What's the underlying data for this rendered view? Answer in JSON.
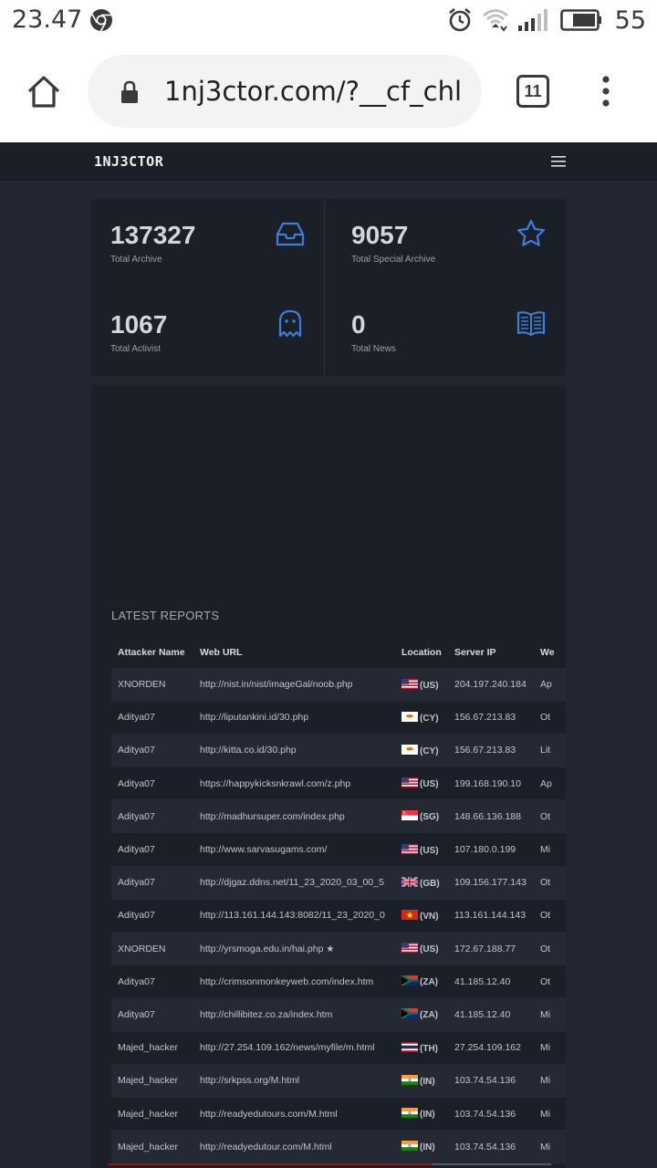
{
  "status_bar": {
    "time": "23.47",
    "battery": "55"
  },
  "browser": {
    "url": "1nj3ctor.com/?__cf_chl",
    "tab_count": "11"
  },
  "site": {
    "logo": "1NJ3CTOR"
  },
  "stats": [
    {
      "value": "137327",
      "label": "Total Archive",
      "icon": "inbox-icon"
    },
    {
      "value": "9057",
      "label": "Total Special Archive",
      "icon": "star-icon"
    },
    {
      "value": "1067",
      "label": "Total Activist",
      "icon": "ghost-icon"
    },
    {
      "value": "0",
      "label": "Total News",
      "icon": "book-icon"
    }
  ],
  "reports": {
    "title": "LATEST REPORTS",
    "columns": [
      "Attacker Name",
      "Web URL",
      "Location",
      "Server IP",
      "We"
    ],
    "rows": [
      {
        "attacker": "XNORDEN",
        "url": "http://nist.in/nist/imageGal/noob.php",
        "flag": "us",
        "cc": "(US)",
        "ip": "204.197.240.184",
        "web": "Ap"
      },
      {
        "attacker": "Aditya07",
        "url": "http://liputankini.id/30.php",
        "flag": "cy",
        "cc": "(CY)",
        "ip": "156.67.213.83",
        "web": "Ot"
      },
      {
        "attacker": "Aditya07",
        "url": "http://kitta.co.id/30.php",
        "flag": "cy",
        "cc": "(CY)",
        "ip": "156.67.213.83",
        "web": "Lit"
      },
      {
        "attacker": "Aditya07",
        "url": "https://happykicksnkrawl.com/z.php",
        "flag": "us",
        "cc": "(US)",
        "ip": "199.168.190.10",
        "web": "Ap"
      },
      {
        "attacker": "Aditya07",
        "url": "http://madhursuper.com/index.php",
        "flag": "sg",
        "cc": "(SG)",
        "ip": "148.66.136.188",
        "web": "Ot"
      },
      {
        "attacker": "Aditya07",
        "url": "http://www.sarvasugams.com/",
        "flag": "us",
        "cc": "(US)",
        "ip": "107.180.0.199",
        "web": "Mi"
      },
      {
        "attacker": "Aditya07",
        "url": "http://djgaz.ddns.net/11_23_2020_03_00_5",
        "flag": "gb",
        "cc": "(GB)",
        "ip": "109.156.177.143",
        "web": "Ot"
      },
      {
        "attacker": "Aditya07",
        "url": "http://113.161.144.143:8082/11_23_2020_0",
        "flag": "vn",
        "cc": "(VN)",
        "ip": "113.161.144.143",
        "web": "Ot"
      },
      {
        "attacker": "XNORDEN",
        "url": "http://yrsmoga.edu.in/hai.php",
        "star": "★",
        "flag": "us",
        "cc": "(US)",
        "ip": "172.67.188.77",
        "web": "Ot"
      },
      {
        "attacker": "Aditya07",
        "url": "http://crimsonmonkeyweb.com/index.htm",
        "flag": "za",
        "cc": "(ZA)",
        "ip": "41.185.12.40",
        "web": "Ot"
      },
      {
        "attacker": "Aditya07",
        "url": "http://chillibitez.co.za/index.htm",
        "flag": "za",
        "cc": "(ZA)",
        "ip": "41.185.12.40",
        "web": "Mi"
      },
      {
        "attacker": "Majed_hacker",
        "url": "http://27.254.109.162/news/myfile/m.html",
        "flag": "th",
        "cc": "(TH)",
        "ip": "27.254.109.162",
        "web": "Mi"
      },
      {
        "attacker": "Majed_hacker",
        "url": "http://srkpss.org/M.html",
        "flag": "in",
        "cc": "(IN)",
        "ip": "103.74.54.136",
        "web": "Mi"
      },
      {
        "attacker": "Majed_hacker",
        "url": "http://readyedutours.com/M.html",
        "flag": "in",
        "cc": "(IN)",
        "ip": "103.74.54.136",
        "web": "Mi"
      },
      {
        "attacker": "Majed_hacker",
        "url": "http://readyedutour.com/M.html",
        "flag": "in",
        "cc": "(IN)",
        "ip": "103.74.54.136",
        "web": "Mi"
      }
    ]
  }
}
